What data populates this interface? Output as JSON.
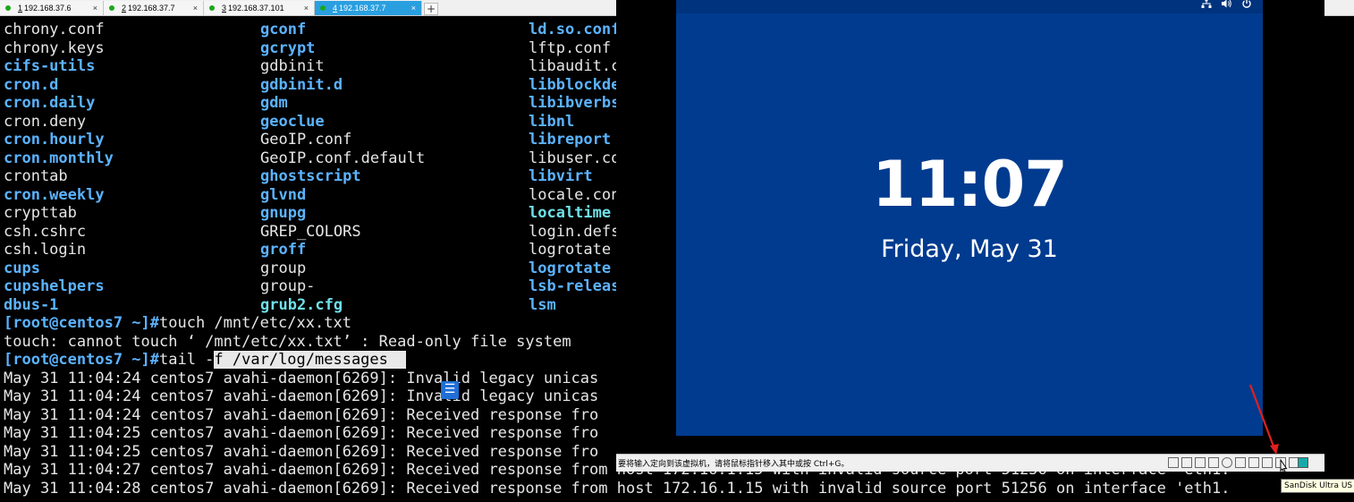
{
  "tabs": [
    {
      "number": "1",
      "host": " 192.168.37.6",
      "active": false
    },
    {
      "number": "2",
      "host": " 192.168.37.7",
      "active": false
    },
    {
      "number": "3",
      "host": " 192.168.37.101",
      "active": false
    },
    {
      "number": "4",
      "host": " 192.168.37.7",
      "active": true
    }
  ],
  "tab_close_glyph": "×",
  "new_tab_glyph": "+",
  "listing": {
    "col1": [
      {
        "t": "chrony.conf",
        "k": "pl"
      },
      {
        "t": "chrony.keys",
        "k": "pl"
      },
      {
        "t": "cifs-utils",
        "k": "dir"
      },
      {
        "t": "cron.d",
        "k": "dir"
      },
      {
        "t": "cron.daily",
        "k": "dir"
      },
      {
        "t": "cron.deny",
        "k": "pl"
      },
      {
        "t": "cron.hourly",
        "k": "dir"
      },
      {
        "t": "cron.monthly",
        "k": "dir"
      },
      {
        "t": "crontab",
        "k": "pl"
      },
      {
        "t": "cron.weekly",
        "k": "dir"
      },
      {
        "t": "crypttab",
        "k": "pl"
      },
      {
        "t": "csh.cshrc",
        "k": "pl"
      },
      {
        "t": "csh.login",
        "k": "pl"
      },
      {
        "t": "cups",
        "k": "dir"
      },
      {
        "t": "cupshelpers",
        "k": "dir"
      },
      {
        "t": "dbus-1",
        "k": "dir"
      }
    ],
    "col2": [
      {
        "t": "gconf",
        "k": "dir"
      },
      {
        "t": "gcrypt",
        "k": "dir"
      },
      {
        "t": "gdbinit",
        "k": "pl"
      },
      {
        "t": "gdbinit.d",
        "k": "dir"
      },
      {
        "t": "gdm",
        "k": "dir"
      },
      {
        "t": "geoclue",
        "k": "dir"
      },
      {
        "t": "GeoIP.conf",
        "k": "pl"
      },
      {
        "t": "GeoIP.conf.default",
        "k": "pl"
      },
      {
        "t": "ghostscript",
        "k": "dir"
      },
      {
        "t": "glvnd",
        "k": "dir"
      },
      {
        "t": "gnupg",
        "k": "dir"
      },
      {
        "t": "GREP_COLORS",
        "k": "pl"
      },
      {
        "t": "groff",
        "k": "dir"
      },
      {
        "t": "group",
        "k": "pl"
      },
      {
        "t": "group-",
        "k": "pl"
      },
      {
        "t": "grub2.cfg",
        "k": "lnk"
      }
    ],
    "col3": [
      {
        "t": "ld.so.conf",
        "k": "dir"
      },
      {
        "t": "lftp.conf",
        "k": "pl"
      },
      {
        "t": "libaudit.c",
        "k": "pl"
      },
      {
        "t": "libblockde",
        "k": "dir"
      },
      {
        "t": "libibverbs",
        "k": "dir"
      },
      {
        "t": "libnl",
        "k": "dir"
      },
      {
        "t": "libreport",
        "k": "dir"
      },
      {
        "t": "libuser.co",
        "k": "pl"
      },
      {
        "t": "libvirt",
        "k": "dir"
      },
      {
        "t": "locale.con",
        "k": "pl"
      },
      {
        "t": "localtime",
        "k": "lnk"
      },
      {
        "t": "login.defs",
        "k": "pl"
      },
      {
        "t": "logrotate",
        "k": "pl"
      },
      {
        "t": "logrotate",
        "k": "dir"
      },
      {
        "t": "lsb-releas",
        "k": "dir"
      },
      {
        "t": "lsm",
        "k": "dir"
      }
    ]
  },
  "commands": {
    "prompt": "[root@centos7 ~]#",
    "cmd1": "touch /mnt/etc/xx.txt",
    "err1": "touch: cannot touch ‘ /mnt/etc/xx.txt’ : Read-only file system",
    "cmd2_pre": "tail -",
    "cmd2_sel": "f /var/log/messages  "
  },
  "log_lines": [
    "May 31 11:04:24 centos7 avahi-daemon[6269]: Invalid legacy unicas",
    "May 31 11:04:24 centos7 avahi-daemon[6269]: Invalid legacy unicas",
    "May 31 11:04:24 centos7 avahi-daemon[6269]: Received response fro",
    "May 31 11:04:25 centos7 avahi-daemon[6269]: Received response fro",
    "May 31 11:04:25 centos7 avahi-daemon[6269]: Received response fro",
    "May 31 11:04:27 centos7 avahi-daemon[6269]: Received response from host 172.16.1.15 with invalid source port 51256 on interface 'eth1.",
    "May 31 11:04:28 centos7 avahi-daemon[6269]: Received response from host 172.16.1.15 with invalid source port 51256 on interface 'eth1."
  ],
  "vm": {
    "time": "11:07",
    "date": "Friday, May 31",
    "tray_icons": [
      "network-icon",
      "volume-icon",
      "power-icon"
    ],
    "status_hint": "要将输入定向到该虚拟机，请将鼠标指针移入其中或按 Ctrl+G。",
    "tooltip": "SanDisk Ultra US"
  },
  "colors": {
    "lockscreen_bg": "#003b8f",
    "directory": "#5bb3ff",
    "symlink": "#6fe0e8",
    "active_tab": "#2a9fe0"
  }
}
